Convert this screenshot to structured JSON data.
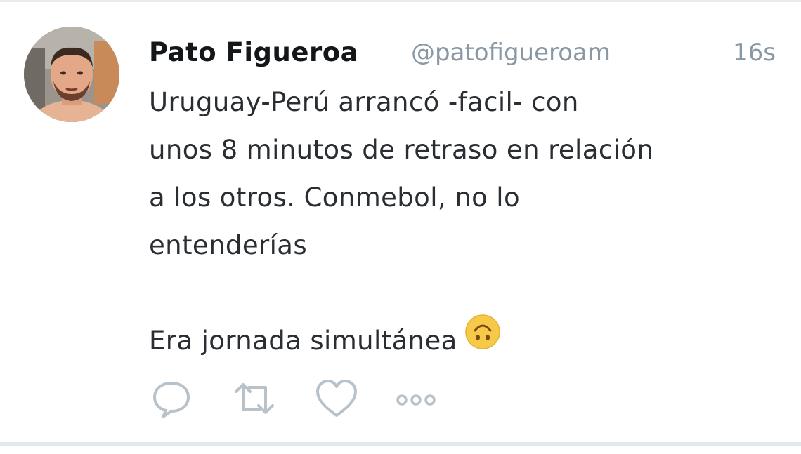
{
  "tweet": {
    "author_name": "Pato Figueroa",
    "author_handle": "@patofigueroam",
    "timestamp": "16s",
    "text_lines": [
      "Uruguay-Perú arrancó -facil- con",
      "unos 8 minutos de retraso en relación",
      "a los otros. Conmebol, no lo",
      "entenderías"
    ],
    "last_line": "Era jornada simultánea",
    "emoji": "upside-down-face"
  },
  "actions": {
    "reply_icon": "reply-icon",
    "retweet_icon": "retweet-icon",
    "like_icon": "heart-icon",
    "more_icon": "more-icon"
  },
  "colors": {
    "text": "#14171a",
    "secondary": "#8a98a4",
    "icon": "#b8c2cb",
    "emoji": "#f7c948",
    "divider": "#e1e8ed"
  }
}
